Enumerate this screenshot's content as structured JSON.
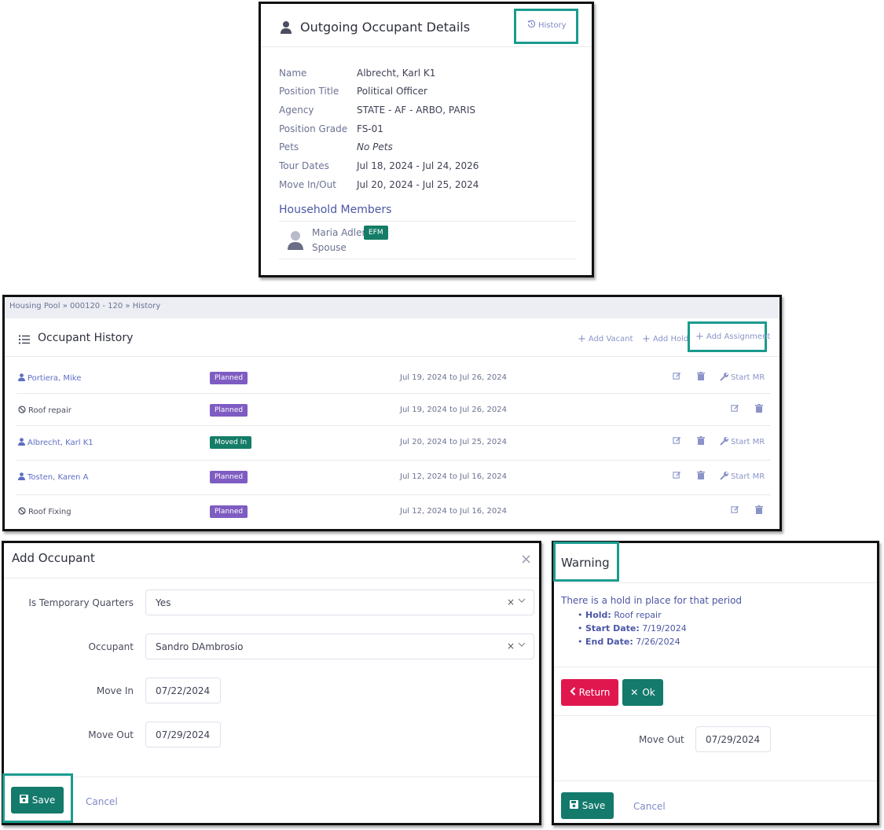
{
  "outgoing": {
    "title": "Outgoing Occupant Details",
    "history_label": "History",
    "fields": [
      {
        "label": "Name",
        "value": "Albrecht, Karl K1"
      },
      {
        "label": "Position Title",
        "value": "Political Officer"
      },
      {
        "label": "Agency",
        "value": "STATE - AF - ARBO, PARIS"
      },
      {
        "label": "Position Grade",
        "value": "FS-01"
      },
      {
        "label": "Pets",
        "value": "No Pets"
      },
      {
        "label": "Tour Dates",
        "value": "Jul 18, 2024 - Jul 24, 2026"
      },
      {
        "label": "Move In/Out",
        "value": "Jul 20, 2024 - Jul 25, 2024"
      }
    ],
    "household_title": "Household Members",
    "member": {
      "name": "Maria Adler",
      "badge": "EFM",
      "relation": "Spouse"
    }
  },
  "history": {
    "breadcrumb": "Housing Pool » 000120 - 120 » History",
    "title": "Occupant History",
    "add_vacant": "Add Vacant",
    "add_hold": "Add Hold",
    "add_assignment": "Add Assignment",
    "start_mr": "Start MR",
    "rows": [
      {
        "name": "Portiera, Mike",
        "type": "person",
        "status": "Planned",
        "dates": "Jul 19, 2024 to Jul 26, 2024"
      },
      {
        "name": "Roof repair",
        "type": "hold",
        "status": "Planned",
        "dates": "Jul 19, 2024 to Jul 26, 2024"
      },
      {
        "name": "Albrecht, Karl K1",
        "type": "person",
        "status": "Moved In",
        "dates": "Jul 20, 2024 to Jul 25, 2024"
      },
      {
        "name": "Tosten, Karen A",
        "type": "person",
        "status": "Planned",
        "dates": "Jul 12, 2024 to Jul 16, 2024"
      },
      {
        "name": "Roof Fixing",
        "type": "hold",
        "status": "Planned",
        "dates": "Jul 12, 2024 to Jul 16, 2024"
      }
    ]
  },
  "add_occupant": {
    "title": "Add Occupant",
    "temp_label": "Is Temporary Quarters",
    "temp_value": "Yes",
    "occupant_label": "Occupant",
    "occupant_value": "Sandro DAmbrosio",
    "move_in_label": "Move In",
    "move_in_value": "07/22/2024",
    "move_out_label": "Move Out",
    "move_out_value": "07/29/2024",
    "save_label": "Save",
    "cancel_label": "Cancel"
  },
  "warning": {
    "title": "Warning",
    "message": "There is a hold in place for that period",
    "hold_label": "Hold:",
    "hold_value": "Roof repair",
    "start_label": "Start Date:",
    "start_value": "7/19/2024",
    "end_label": "End Date:",
    "end_value": "7/26/2024",
    "return_label": "Return",
    "ok_label": "Ok",
    "move_out_label": "Move Out",
    "move_out_value": "07/29/2024",
    "save_label": "Save",
    "cancel_label": "Cancel"
  },
  "colors": {
    "teal": "#137a6c",
    "highlight": "#1a9b8e",
    "planned": "#7e5cc2",
    "moved_in": "#157d67",
    "return": "#e0174f",
    "link": "#5d6ec5"
  }
}
